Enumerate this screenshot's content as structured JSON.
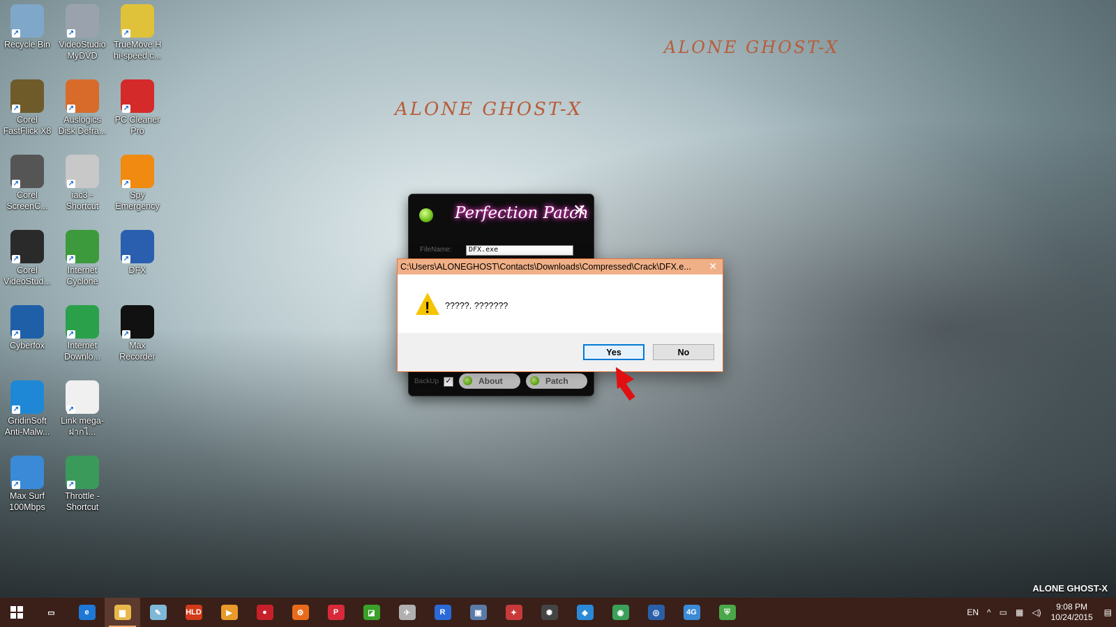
{
  "wallpaper": {
    "watermark_1": "ALONE GHOST-X",
    "watermark_2": "ALONE GHOST-X",
    "corner_brand": "ALONE GHOST-X"
  },
  "desktop_icons": [
    {
      "label": "Recycle Bin",
      "color": "#7fa7c9"
    },
    {
      "label": "VideoStudio MyDVD",
      "color": "#9aa3ad"
    },
    {
      "label": "TrueMove H hi-speed c...",
      "color": "#e0c23a"
    },
    {
      "label": "Corel FastFlick X8",
      "color": "#6f5a2a"
    },
    {
      "label": "Auslogics Disk Defra...",
      "color": "#d86a2a"
    },
    {
      "label": "PC Cleaner Pro",
      "color": "#d42a2a"
    },
    {
      "label": "Corel ScreenC...",
      "color": "#555555"
    },
    {
      "label": "iac3 - Shortcut",
      "color": "#c8c8c8"
    },
    {
      "label": "Spy Emergency",
      "color": "#f08a10"
    },
    {
      "label": "Corel VideoStud...",
      "color": "#2a2a2a"
    },
    {
      "label": "Internet Cyclone",
      "color": "#3c9a3c"
    },
    {
      "label": "DFX",
      "color": "#2a5fb0"
    },
    {
      "label": "Cyberfox",
      "color": "#1f5fa8"
    },
    {
      "label": "Internet Downlo...",
      "color": "#2aa04a"
    },
    {
      "label": "Max Recorder",
      "color": "#111111"
    },
    {
      "label": "GridinSoft Anti-Malw...",
      "color": "#1e88d6"
    },
    {
      "label": "Link mega-ฝากไ...",
      "color": "#f0f0f0"
    },
    {
      "label": "",
      "color": "#00000000"
    },
    {
      "label": "Max Surf 100Mbps",
      "color": "#3a8ad8"
    },
    {
      "label": "Throttle - Shortcut",
      "color": "#3a9a5a"
    }
  ],
  "patch_window": {
    "title": "Perfection Patch",
    "filename_label": "FileName:",
    "filename_value": "DFX.exe",
    "backup_label": "BackUp",
    "backup_checked_glyph": "✓",
    "about_label": "About",
    "patch_label": "Patch",
    "close_glyph": "✕"
  },
  "message_box": {
    "title": "C:\\Users\\ALONEGHOST\\Contacts\\Downloads\\Compressed\\Crack\\DFX.e...",
    "close_glyph": "✕",
    "message": "?????. ???????",
    "warning_glyph": "!",
    "yes_label": "Yes",
    "no_label": "No"
  },
  "taskbar": {
    "items": [
      {
        "name": "task-view",
        "glyph": "▭",
        "color": "#3a2018"
      },
      {
        "name": "edge",
        "glyph": "e",
        "color": "#1e78d6"
      },
      {
        "name": "file-explorer",
        "glyph": "▆",
        "color": "#e8b84a"
      },
      {
        "name": "notepad",
        "glyph": "✎",
        "color": "#7fb8d8"
      },
      {
        "name": "hld",
        "glyph": "HLD",
        "color": "#d23a1a"
      },
      {
        "name": "media-player",
        "glyph": "▶",
        "color": "#e89a2a"
      },
      {
        "name": "app-red",
        "glyph": "●",
        "color": "#c8202a"
      },
      {
        "name": "settings",
        "glyph": "⚙",
        "color": "#e86a1a"
      },
      {
        "name": "app-p",
        "glyph": "P",
        "color": "#d82a3a"
      },
      {
        "name": "app-green",
        "glyph": "◪",
        "color": "#3aa02a"
      },
      {
        "name": "app-plane",
        "glyph": "✈",
        "color": "#b0b0b0"
      },
      {
        "name": "app-r",
        "glyph": "R",
        "color": "#2a6ad8"
      },
      {
        "name": "app-monitor",
        "glyph": "▣",
        "color": "#5a7aa8"
      },
      {
        "name": "app-paint",
        "glyph": "✦",
        "color": "#c83a3a"
      },
      {
        "name": "app-reel",
        "glyph": "✺",
        "color": "#444444"
      },
      {
        "name": "app-map",
        "glyph": "◆",
        "color": "#2a8ad8"
      },
      {
        "name": "app-globe",
        "glyph": "◉",
        "color": "#3aa05a"
      },
      {
        "name": "app-fox",
        "glyph": "◎",
        "color": "#2a5fa8"
      },
      {
        "name": "app-4g",
        "glyph": "4G",
        "color": "#3a8ad8"
      },
      {
        "name": "app-shield",
        "glyph": "⛨",
        "color": "#4aa84a"
      }
    ],
    "tray_language": "EN",
    "tray_chevron": "^",
    "tray_battery": "▭",
    "tray_network": "▦",
    "tray_volume": "◁)",
    "tray_notify": "▤",
    "time": "9:08 PM",
    "date": "10/24/2015"
  }
}
